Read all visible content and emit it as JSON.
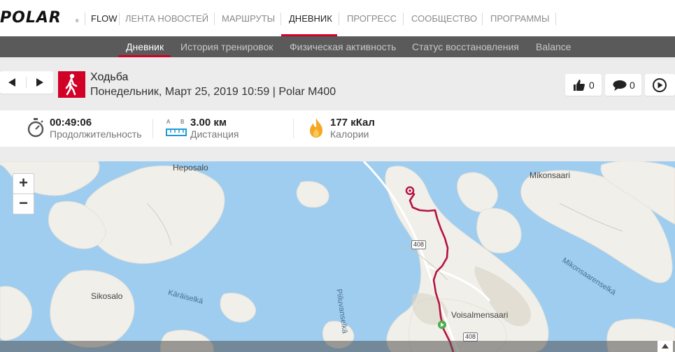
{
  "brand": {
    "logo": "POLAR",
    "reg": "®"
  },
  "nav": {
    "flow": "FLOW",
    "items": [
      "ЛЕНТА НОВОСТЕЙ",
      "МАРШРУТЫ",
      "ДНЕВНИК",
      "ПРОГРЕСС",
      "СООБЩЕСТВО",
      "ПРОГРАММЫ"
    ],
    "active": "ДНЕВНИК"
  },
  "subnav": {
    "items": [
      "Дневник",
      "История тренировок",
      "Физическая активность",
      "Статус восстановления",
      "Balance"
    ],
    "active": "Дневник"
  },
  "session": {
    "sport": "Ходьба",
    "details": "Понедельник, Март 25, 2019 10:59 | Polar M400",
    "likes": "0",
    "comments": "0"
  },
  "stats": {
    "duration": {
      "value": "00:49:06",
      "label": "Продолжительность"
    },
    "distance": {
      "value": "3.00 км",
      "label": "Дистанция",
      "a": "A",
      "b": "B"
    },
    "calories": {
      "value": "177 кКал",
      "label": "Калории"
    }
  },
  "map": {
    "labels": [
      "Heposalo",
      "Mikonsaari",
      "Sikosalo",
      "Voisalmensaari"
    ],
    "water_labels": [
      "Käräiselkä",
      "Piiluvanselkä",
      "Mikonsaarenselkä"
    ],
    "road": "408",
    "zoom_in": "+",
    "zoom_out": "−"
  },
  "colors": {
    "accent": "#d10027",
    "water": "#9ecdf0",
    "land": "#f1efe9",
    "route": "#b5123f"
  },
  "icons": [
    "prev-arrow-icon",
    "next-arrow-icon",
    "walking-icon",
    "thumbs-up-icon",
    "comment-icon",
    "play-icon",
    "stopwatch-icon",
    "distance-ruler-icon",
    "flame-icon"
  ]
}
